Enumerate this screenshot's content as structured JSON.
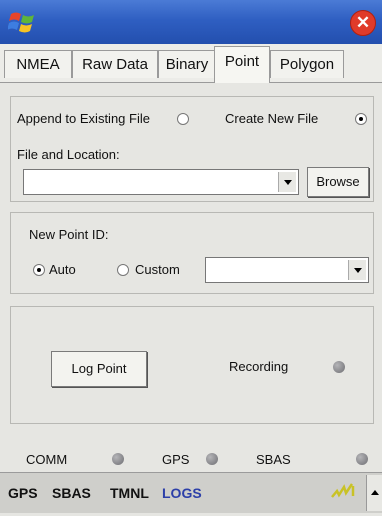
{
  "tabs": [
    {
      "label": "NMEA",
      "active": false
    },
    {
      "label": "Raw Data",
      "active": false
    },
    {
      "label": "Binary",
      "active": false
    },
    {
      "label": "Point",
      "active": true
    },
    {
      "label": "Polygon",
      "active": false
    }
  ],
  "file_section": {
    "append_label": "Append to Existing File",
    "append_selected": false,
    "create_label": "Create New File",
    "create_selected": true,
    "location_label": "File and Location:",
    "location_value": "",
    "browse_label": "Browse"
  },
  "point_id_section": {
    "label": "New Point ID:",
    "auto_label": "Auto",
    "auto_selected": true,
    "custom_label": "Custom",
    "custom_selected": false,
    "custom_value": ""
  },
  "log_section": {
    "log_button": "Log Point",
    "recording_label": "Recording"
  },
  "indicators": [
    {
      "label": "COMM"
    },
    {
      "label": "GPS"
    },
    {
      "label": "SBAS"
    }
  ],
  "status_bar": {
    "items": [
      "GPS",
      "SBAS",
      "TMNL",
      "LOGS"
    ],
    "accent_color": "#2c3fa8"
  }
}
